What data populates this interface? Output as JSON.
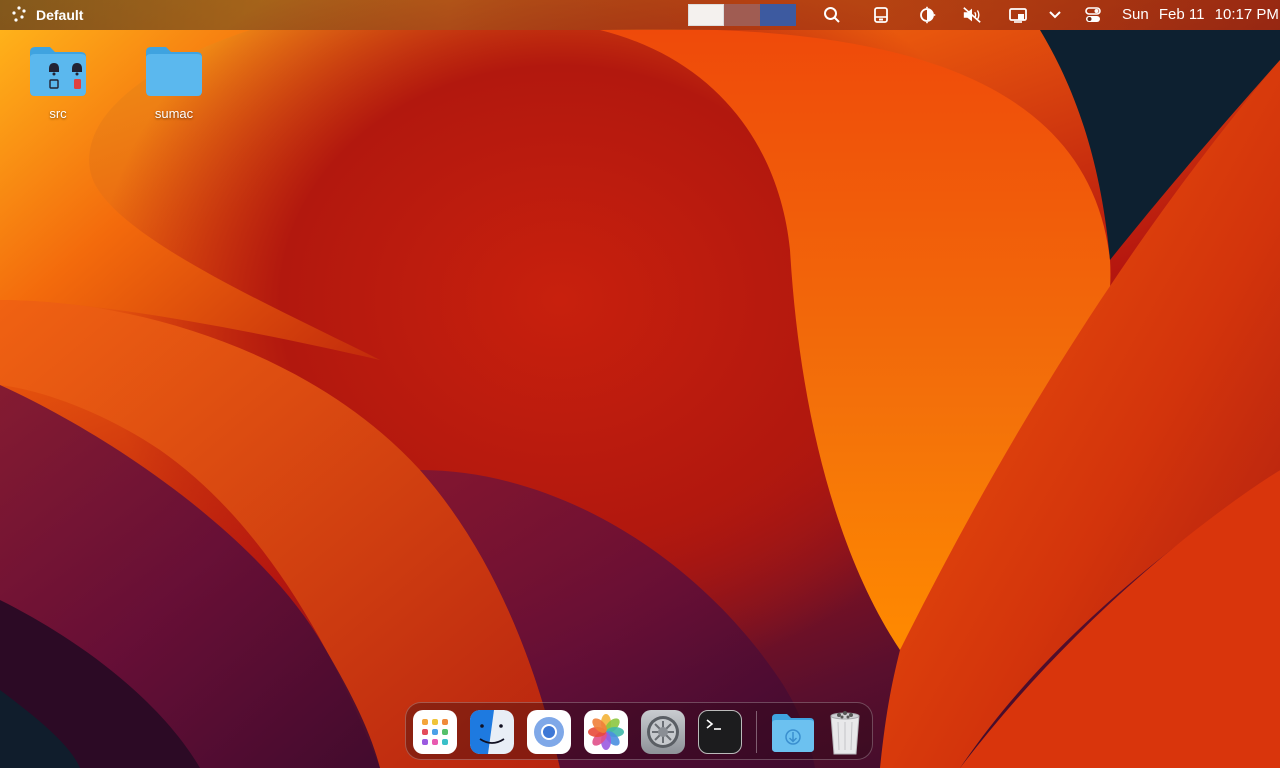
{
  "menubar": {
    "app_name": "Default",
    "logo_icon": "dots-logo-icon",
    "spaces": [
      "space-1",
      "space-2",
      "space-3"
    ],
    "tray_icons": [
      "search-icon",
      "tablet-icon",
      "night-shift-icon",
      "volume-muted-icon",
      "screen-mirroring-icon",
      "chevron-down-icon",
      "control-center-icon"
    ],
    "clock": {
      "day": "Sun",
      "date": "Feb 11",
      "time": "10:17 PM"
    }
  },
  "desktop": {
    "items": [
      {
        "label": "src",
        "icon": "folder-icon-with-badges"
      },
      {
        "label": "sumac",
        "icon": "folder-icon"
      }
    ]
  },
  "dock": {
    "apps": [
      "launchpad-icon",
      "finder-icon",
      "chromium-icon",
      "photos-icon",
      "system-preferences-icon",
      "terminal-icon"
    ],
    "stack": [
      "downloads-folder-icon",
      "trash-icon"
    ]
  },
  "colors": {
    "folder_blue": "#5bb8ee",
    "accent_orange": "#f07a10",
    "accent_red": "#c41d0d"
  }
}
